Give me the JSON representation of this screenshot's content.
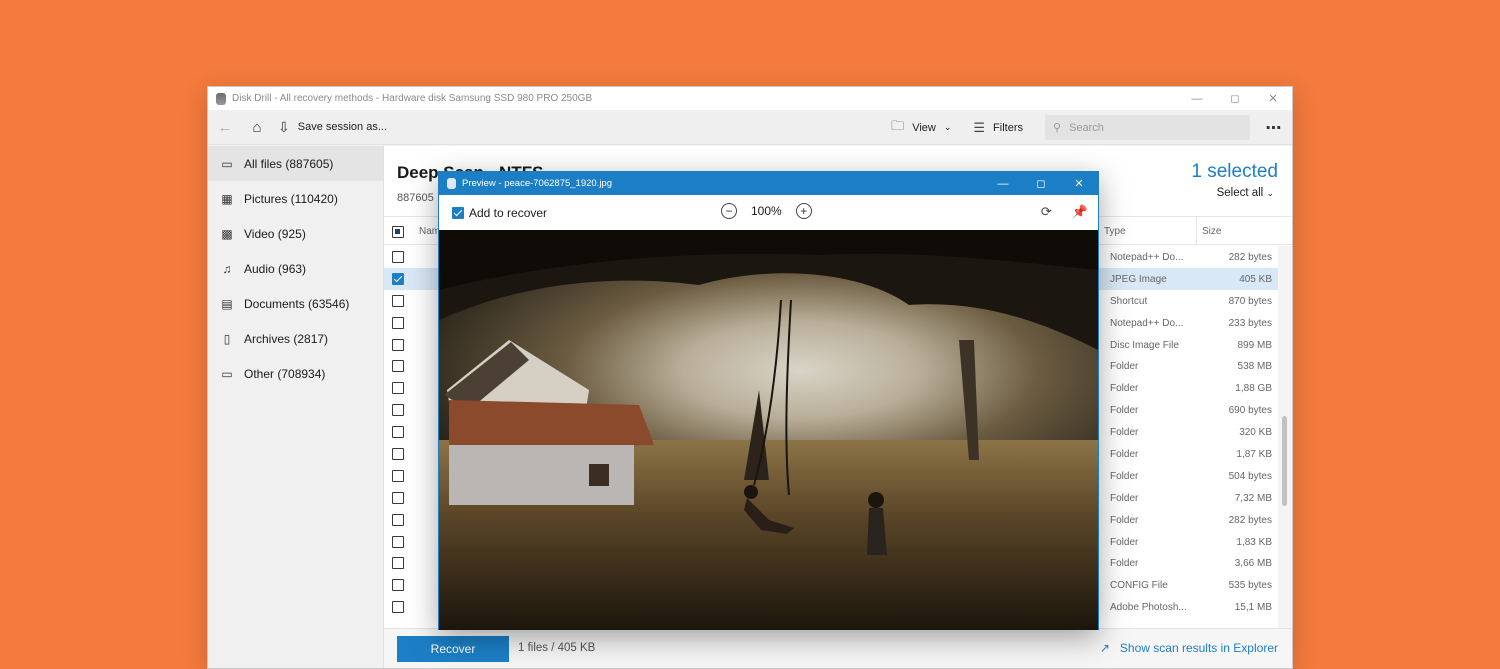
{
  "window": {
    "title": "Disk Drill - All recovery methods - Hardware disk Samsung SSD 980 PRO 250GB"
  },
  "toolbar": {
    "back_icon": "back-arrow-icon",
    "home_icon": "home-icon",
    "save_session": "Save session as...",
    "view": "View",
    "filters": "Filters",
    "search_placeholder": "Search"
  },
  "sidebar": {
    "items": [
      {
        "label": "All files (887605)",
        "icon": "all-files-icon",
        "active": true
      },
      {
        "label": "Pictures (110420)",
        "icon": "pictures-icon"
      },
      {
        "label": "Video (925)",
        "icon": "video-icon"
      },
      {
        "label": "Audio (963)",
        "icon": "audio-icon"
      },
      {
        "label": "Documents (63546)",
        "icon": "documents-icon"
      },
      {
        "label": "Archives (2817)",
        "icon": "archives-icon"
      },
      {
        "label": "Other (708934)",
        "icon": "other-icon"
      }
    ]
  },
  "main": {
    "scan_title": "Deep Scan - NTFS",
    "scan_subtitle": "887605",
    "selected_count": "1 selected",
    "select_all": "Select all",
    "columns": {
      "name": "Name",
      "type": "Type",
      "size": "Size"
    }
  },
  "rows": [
    {
      "type": "Notepad++ Do...",
      "size": "282 bytes",
      "checked": false
    },
    {
      "type": "JPEG Image",
      "size": "405 KB",
      "checked": true
    },
    {
      "type": "Shortcut",
      "size": "870 bytes",
      "checked": false
    },
    {
      "type": "Notepad++ Do...",
      "size": "233 bytes",
      "checked": false
    },
    {
      "type": "Disc Image File",
      "size": "899 MB",
      "checked": false
    },
    {
      "type": "Folder",
      "size": "538 MB",
      "checked": false
    },
    {
      "type": "Folder",
      "size": "1,88 GB",
      "checked": false
    },
    {
      "type": "Folder",
      "size": "690 bytes",
      "checked": false
    },
    {
      "type": "Folder",
      "size": "320 KB",
      "checked": false
    },
    {
      "type": "Folder",
      "size": "1,87 KB",
      "checked": false
    },
    {
      "type": "Folder",
      "size": "504 bytes",
      "checked": false
    },
    {
      "type": "Folder",
      "size": "7,32 MB",
      "checked": false
    },
    {
      "type": "Folder",
      "size": "282 bytes",
      "checked": false
    },
    {
      "type": "Folder",
      "size": "1,83 KB",
      "checked": false
    },
    {
      "type": "Folder",
      "size": "3,66 MB",
      "checked": false
    },
    {
      "type": "CONFIG File",
      "size": "535 bytes",
      "checked": false
    },
    {
      "type": "Adobe Photosh...",
      "size": "15,1 MB",
      "checked": false
    }
  ],
  "footer": {
    "recover": "Recover",
    "info": "1 files / 405 KB",
    "explorer_link": "Show scan results in Explorer"
  },
  "preview": {
    "title": "Preview - peace-7062875_1920.jpg",
    "add_to_recover": "Add to recover",
    "zoom": "100%"
  },
  "colors": {
    "background": "#f47a3d",
    "accent": "#1c7fc6",
    "selected_row": "#d9e8f6"
  }
}
